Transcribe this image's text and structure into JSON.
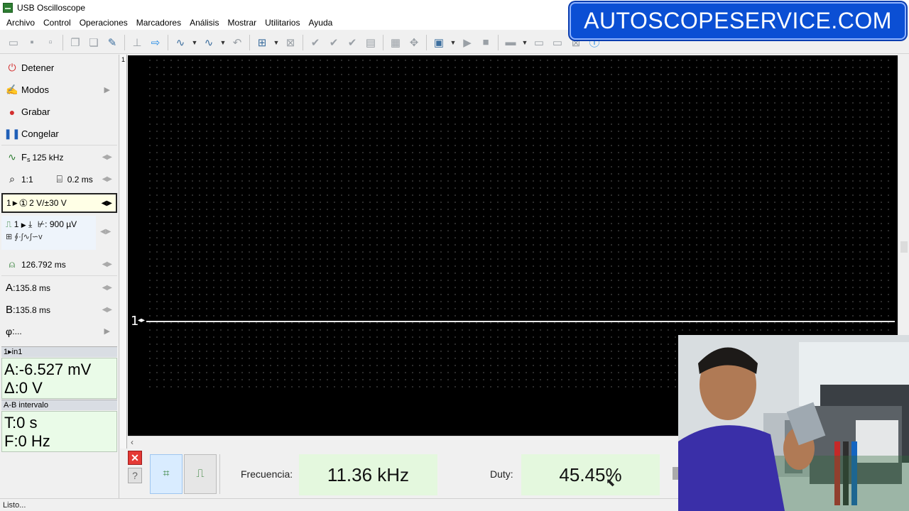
{
  "window": {
    "title": "USB Oscilloscope"
  },
  "banner": {
    "text": "AUTOSCOPESERVICE.COM"
  },
  "menu": [
    "Archivo",
    "Control",
    "Operaciones",
    "Marcadores",
    "Análisis",
    "Mostrar",
    "Utilitarios",
    "Ayuda"
  ],
  "toolbar": {
    "icons": [
      "open-icon",
      "save-icon",
      "save-as-icon",
      "copy-icon",
      "paste-icon",
      "probe-icon",
      "cursor-icon",
      "export-icon",
      "filter-icon",
      "filter2-icon",
      "undo-icon",
      "zoom-icon",
      "marker-icon",
      "check-icon",
      "check2-icon",
      "check3-icon",
      "doc-icon",
      "grid-icon",
      "move-icon",
      "folder-icon",
      "play-icon",
      "stop-icon",
      "layout-icon",
      "window-icon",
      "window2-icon",
      "tile-icon",
      "info-icon"
    ]
  },
  "left_panel": {
    "stop": "Detener",
    "modes": "Modos",
    "record": "Grabar",
    "freeze": "Congelar",
    "sample_rate": {
      "symbol": "F",
      "sub": "s",
      "value": "125 kHz"
    },
    "zoom": {
      "ratio": "1:1",
      "timebase": "0.2 ms"
    },
    "channel": {
      "num": "1",
      "range": "2 V/±30 V"
    },
    "trigger": {
      "line1_ch": "1",
      "level": "900 µV"
    },
    "period": "126.792 ms",
    "cursor_a": {
      "label": "A",
      "value": "135.8 ms"
    },
    "cursor_b": {
      "label": "B",
      "value": "135.8 ms"
    },
    "phase": {
      "label": "φ",
      "value": "..."
    }
  },
  "info": {
    "channel_header": "1▸in1",
    "a_value": "A:-6.527 mV",
    "delta_value": "Δ:0 V",
    "interval_header": "A-B intervalo",
    "t_value": "T:0 s",
    "f_value": "F:0 Hz"
  },
  "scope": {
    "channel_label": "1"
  },
  "measure": {
    "freq_label": "Frecuencia:",
    "freq_value": "11.36 kHz",
    "duty_label": "Duty:",
    "duty_value": "45.45%"
  },
  "status": "Listo..."
}
